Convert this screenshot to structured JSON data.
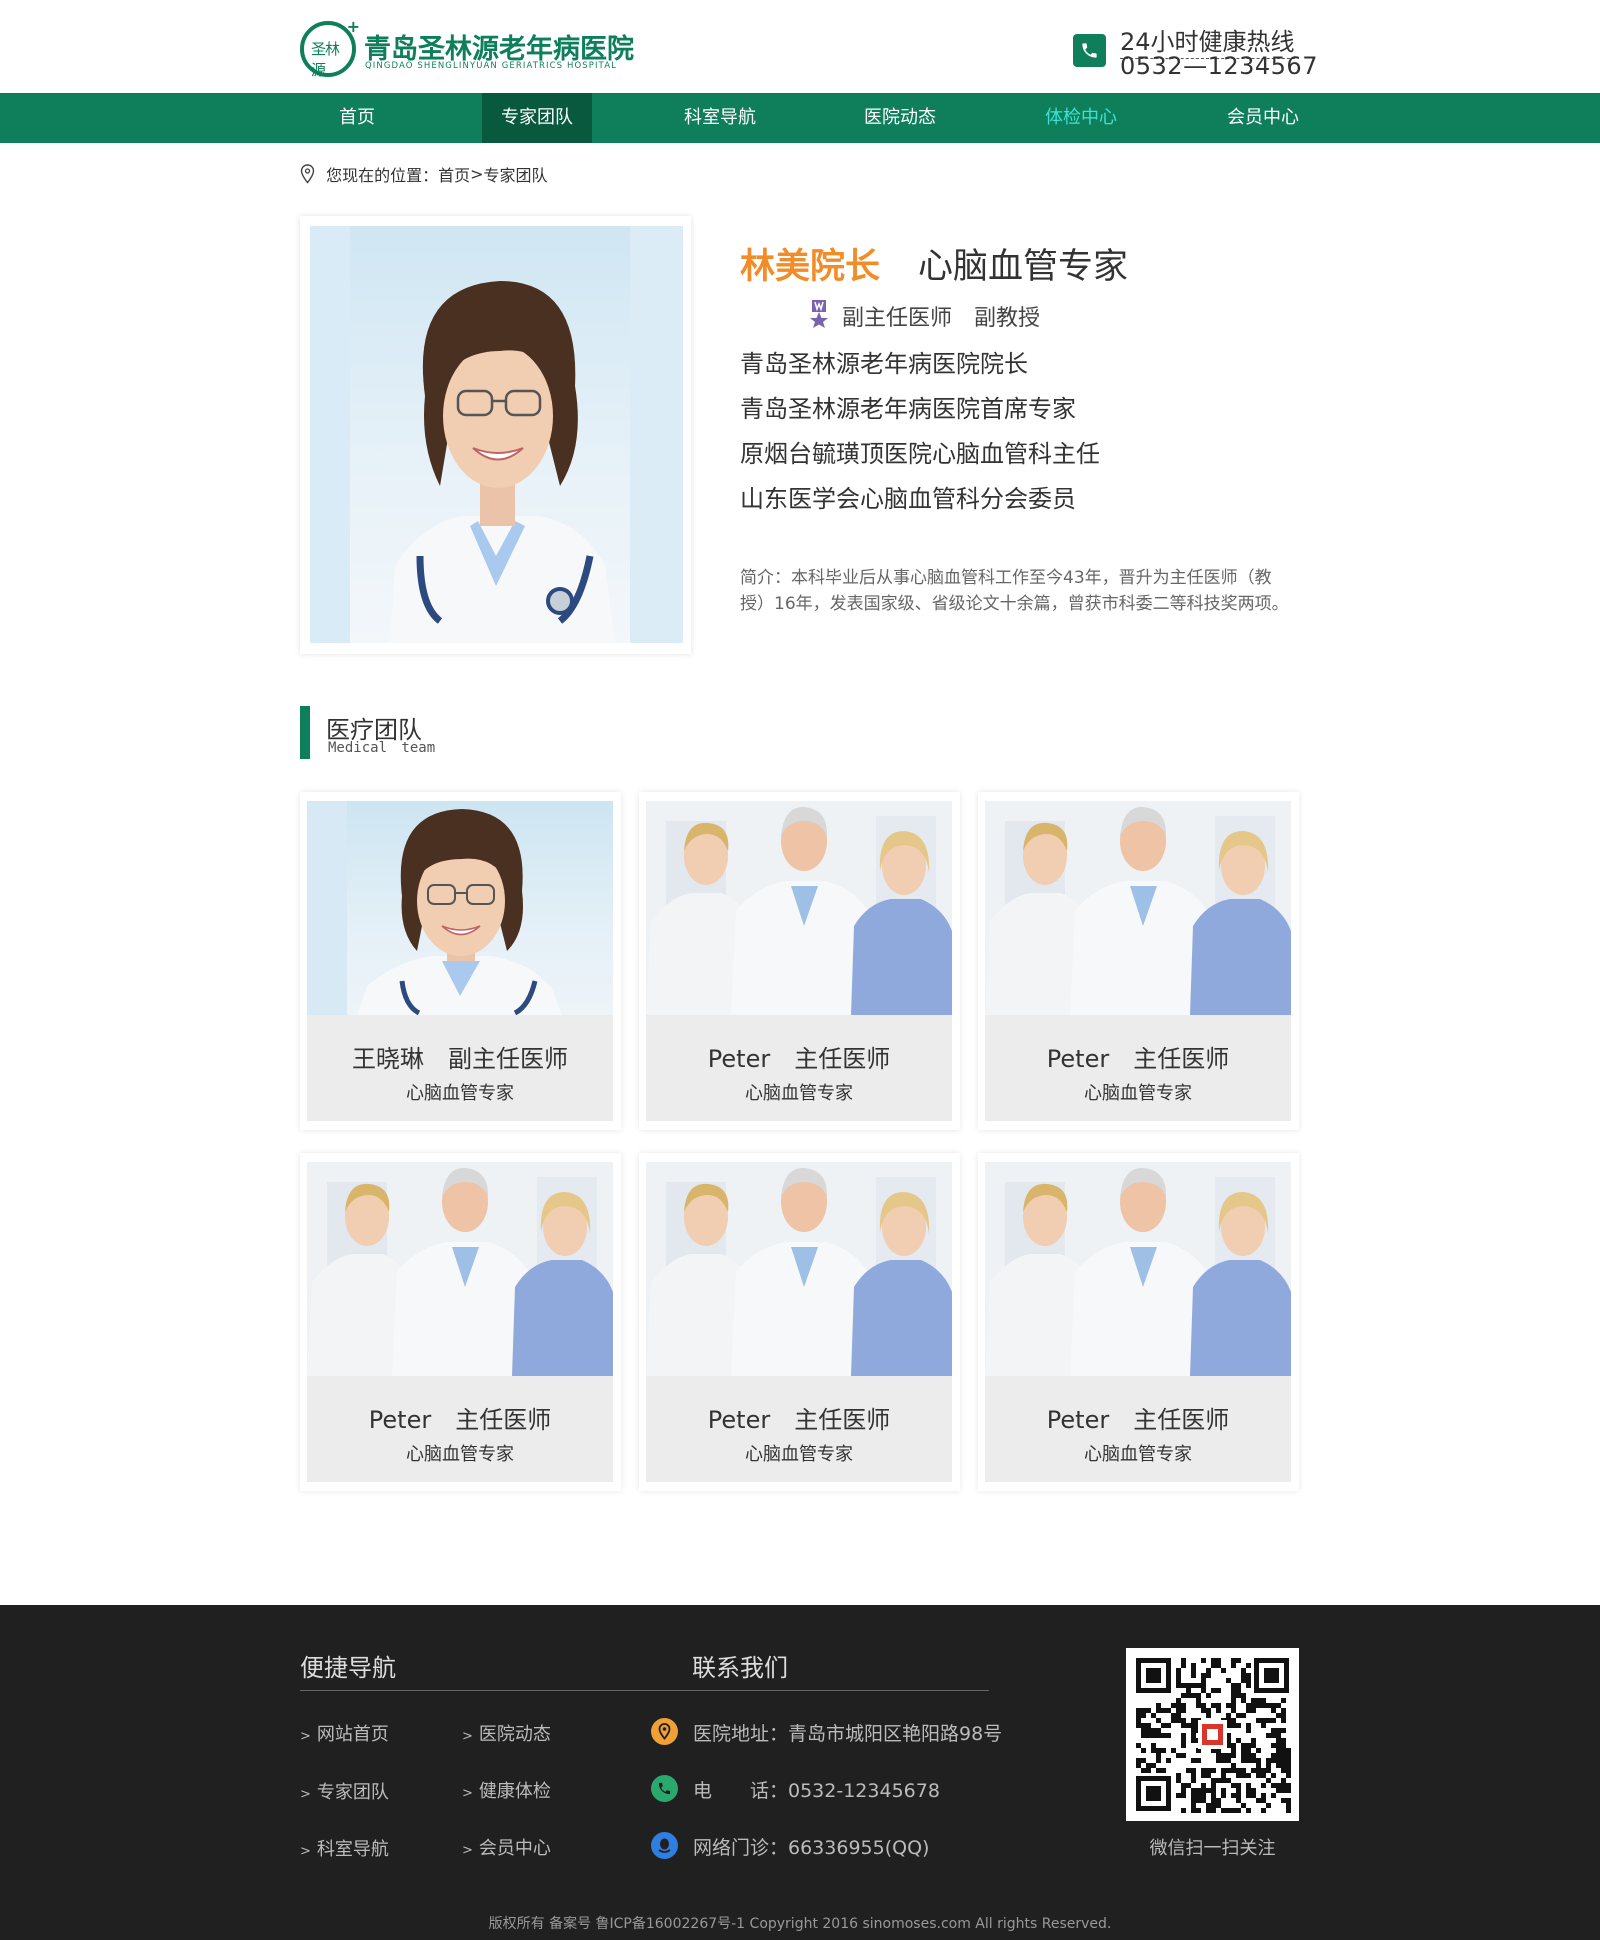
{
  "header": {
    "logo_text": "圣林源",
    "site_title": "青岛圣林源老年病医院",
    "site_subtitle": "QINGDAO SHENGLINYUAN GERIATRICS HOSPITAL",
    "hotline_label": "24小时健康热线",
    "hotline_number": "0532—1234567"
  },
  "nav": {
    "items": [
      {
        "label": "首页"
      },
      {
        "label": "专家团队"
      },
      {
        "label": "科室导航"
      },
      {
        "label": "医院动态"
      },
      {
        "label": "体检中心"
      },
      {
        "label": "会员中心"
      }
    ],
    "active_index": 1,
    "highlight_index": 4
  },
  "breadcrumb": {
    "prefix": "您现在的位置：",
    "home": "首页",
    "separator": ">",
    "current": "专家团队"
  },
  "profile": {
    "name": "林美院长",
    "specialty": "心脑血管专家",
    "titles": "副主任医师　副教授",
    "roles": [
      "青岛圣林源老年病医院院长",
      "青岛圣林源老年病医院首席专家",
      "原烟台毓璜顶医院心脑血管科主任",
      "山东医学会心脑血管科分会委员"
    ],
    "intro": "简介：本科毕业后从事心脑血管科工作至今43年，晋升为主任医师（教授）16年，发表国家级、省级论文十余篇，曾获市科委二等科技奖两项。"
  },
  "team_section": {
    "title": "医疗团队",
    "subtitle": "Medical team"
  },
  "team": [
    {
      "name": "王晓琳　副主任医师",
      "dept": "心脑血管专家",
      "photo": "single"
    },
    {
      "name": "Peter　主任医师",
      "dept": "心脑血管专家",
      "photo": "group"
    },
    {
      "name": "Peter　主任医师",
      "dept": "心脑血管专家",
      "photo": "group"
    },
    {
      "name": "Peter　主任医师",
      "dept": "心脑血管专家",
      "photo": "group"
    },
    {
      "name": "Peter　主任医师",
      "dept": "心脑血管专家",
      "photo": "group"
    },
    {
      "name": "Peter　主任医师",
      "dept": "心脑血管专家",
      "photo": "group"
    }
  ],
  "footer": {
    "nav_heading": "便捷导航",
    "contact_heading": "联系我们",
    "links": [
      "网站首页",
      "医院动态",
      "专家团队",
      "健康体检",
      "科室导航",
      "会员中心"
    ],
    "link_arrow": ">",
    "contacts": [
      {
        "text": "医院地址：青岛市城阳区艳阳路98号",
        "icon": "location-icon",
        "color": "#f0a035"
      },
      {
        "text": "电　　话：0532-12345678",
        "icon": "phone-icon",
        "color": "#2aa86e"
      },
      {
        "text": "网络门诊：66336955(QQ)",
        "icon": "qq-icon",
        "color": "#2f7fe0"
      }
    ],
    "qr_caption": "微信扫一扫关注",
    "copyright": "版权所有 备案号 鲁ICP备16002267号-1 Copyright 2016 sinomoses.com All rights Reserved."
  },
  "colors": {
    "brand_green": "#0e7f5a",
    "nav_active": "#09593f",
    "nav_highlight": "#3ee2d4",
    "name_orange": "#f28c28",
    "footer_bg": "#202020"
  }
}
